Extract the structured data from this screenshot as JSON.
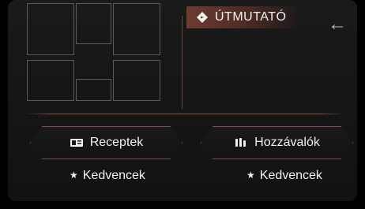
{
  "screen": {
    "guide": {
      "label": "ÚTMUTATÓ"
    },
    "nav": {
      "back_symbol": "←"
    },
    "buttons": [
      {
        "label": "Receptek",
        "icon": "recipe-book-icon"
      },
      {
        "label": "Hozzávalók",
        "icon": "ingredients-icon"
      }
    ],
    "favorites": [
      {
        "label": "Kedvencek",
        "icon": "star-icon"
      },
      {
        "label": "Kedvencek",
        "icon": "star-icon"
      }
    ],
    "colors": {
      "accent": "#7c5246",
      "tab": "#6e3c31",
      "text": "#f1f1f1"
    }
  }
}
